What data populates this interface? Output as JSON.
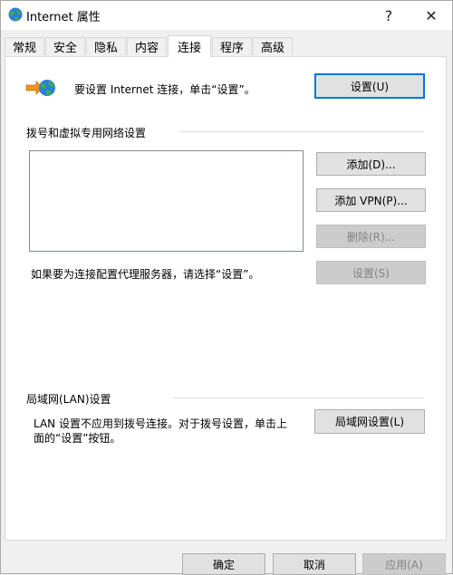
{
  "window": {
    "title": "Internet 属性",
    "help_label": "?",
    "close_label": "✕"
  },
  "tabs": [
    {
      "label": "常规",
      "active": false
    },
    {
      "label": "安全",
      "active": false
    },
    {
      "label": "隐私",
      "active": false
    },
    {
      "label": "内容",
      "active": false
    },
    {
      "label": "连接",
      "active": true
    },
    {
      "label": "程序",
      "active": false
    },
    {
      "label": "高级",
      "active": false
    }
  ],
  "setup": {
    "text": "要设置 Internet 连接，单击“设置”。",
    "button": "设置(U)",
    "icon": "internet-setup-icon"
  },
  "dialup": {
    "section_title": "拨号和虚拟专用网络设置",
    "add_button": "添加(D)...",
    "add_vpn_button": "添加 VPN(P)...",
    "delete_button": "删除(R)...",
    "proxy_text": "如果要为连接配置代理服务器，请选择“设置”。",
    "settings_button": "设置(S)"
  },
  "lan": {
    "section_title": "局域网(LAN)设置",
    "text_line1": "LAN 设置不应用到拨号连接。对于拨号设置，单击上",
    "text_line2": "面的“设置”按钮。",
    "button": "局域网设置(L)"
  },
  "footer": {
    "ok": "确定",
    "cancel": "取消",
    "apply": "应用(A)"
  },
  "colors": {
    "accent": "#0078d7",
    "disabled_text": "#838383"
  }
}
